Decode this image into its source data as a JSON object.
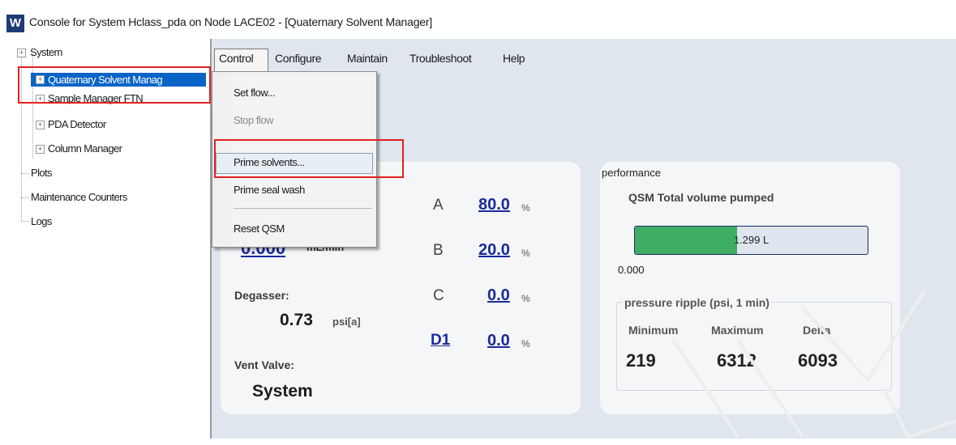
{
  "window": {
    "logo_letter": "W",
    "title": "Console for System Hclass_pda on Node LACE02 - [Quaternary Solvent Manager]"
  },
  "tree": {
    "root": "System",
    "modules": [
      "Quaternary Solvent Manag",
      "Sample Manager FTN",
      "PDA Detector",
      "Column Manager"
    ],
    "items": [
      "Plots",
      "Maintenance Counters",
      "Logs"
    ],
    "expander_glyph": "+"
  },
  "menu": {
    "items": [
      "Control",
      "Configure",
      "Maintain",
      "Troubleshoot",
      "Help"
    ],
    "active": "Control"
  },
  "dropdown": {
    "items": [
      {
        "label": "Set flow...",
        "enabled": true
      },
      {
        "label": "Stop flow",
        "enabled": false
      },
      {
        "label": "Prime solvents...",
        "enabled": true
      },
      {
        "label": "Prime seal wash",
        "enabled": true
      },
      {
        "label": "Reset QSM",
        "enabled": true
      }
    ]
  },
  "status": {
    "flow_value": "0.000",
    "flow_unit": "mL/min",
    "degasser_label": "Degasser:",
    "degasser_value": "0.73",
    "degasser_unit": "psi[a]",
    "vent_label": "Vent Valve:",
    "vent_value": "System"
  },
  "solvents": [
    {
      "letter": "A",
      "value": "80.0",
      "unit": "%"
    },
    {
      "letter": "B",
      "value": "20.0",
      "unit": "%"
    },
    {
      "letter": "C",
      "value": "0.0",
      "unit": "%"
    },
    {
      "letter": "D1",
      "value": "0.0",
      "unit": "%"
    }
  ],
  "performance": {
    "title": "performance",
    "volume_label": "QSM Total volume pumped",
    "volume_value": "1.299 L",
    "volume_fraction": 0.44,
    "scale_min": "0.000",
    "ripple_title": "pressure ripple (psi, 1 min)",
    "headers": [
      "Minimum",
      "Maximum",
      "Delta"
    ],
    "values": [
      "219",
      "6312",
      "6093"
    ]
  },
  "colors": {
    "highlight_box": "#e32020",
    "tree_selection": "#0a64c8",
    "link_blue": "#1a2a9a",
    "progress_fill": "#3fae63"
  }
}
